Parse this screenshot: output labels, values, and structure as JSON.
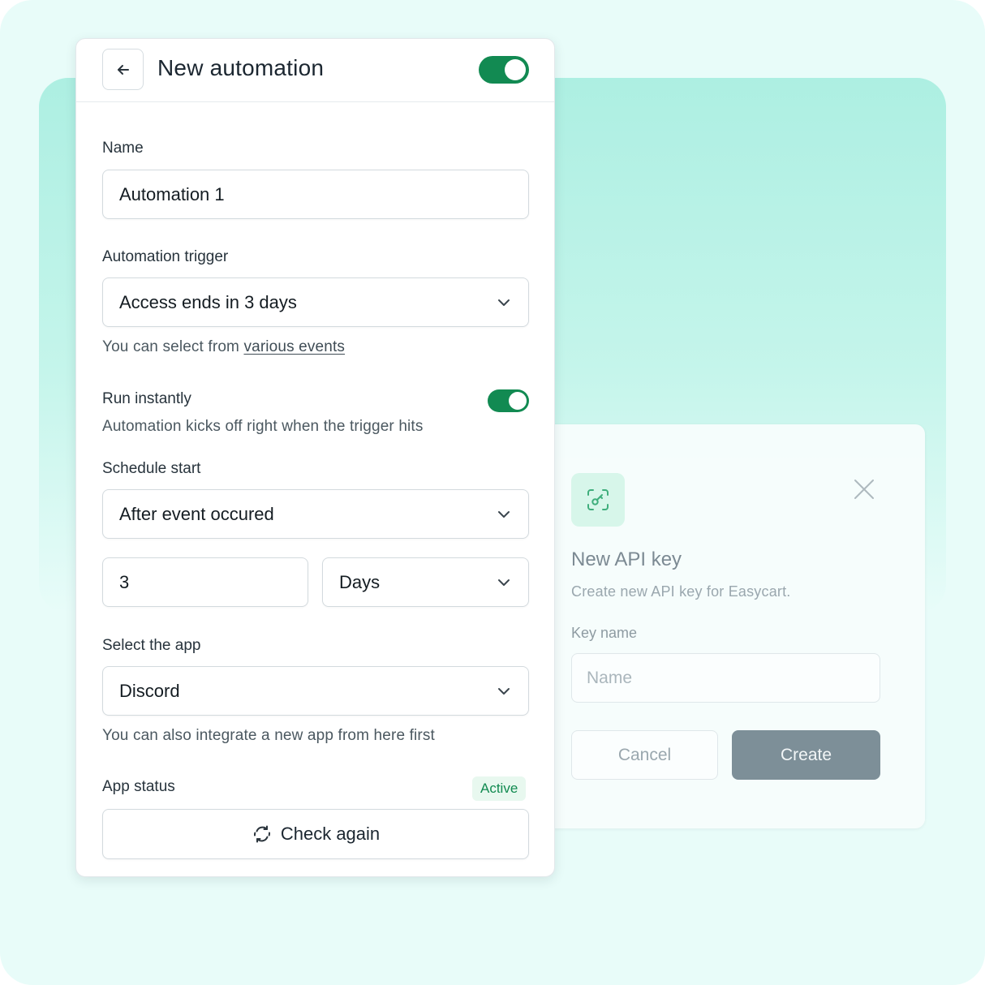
{
  "automation": {
    "title": "New automation",
    "enabled": true,
    "name_label": "Name",
    "name_value": "Automation 1",
    "trigger_label": "Automation trigger",
    "trigger_value": "Access ends in 3 days",
    "trigger_helper_prefix": "You can select from ",
    "trigger_helper_link": "various events",
    "run_instantly_label": "Run instantly",
    "run_instantly_enabled": true,
    "run_instantly_helper": "Automation kicks off right when the trigger hits",
    "schedule_label": "Schedule start",
    "schedule_value": "After event occured",
    "delay_amount": "3",
    "delay_unit": "Days",
    "app_label": "Select the app",
    "app_value": "Discord",
    "app_helper": "You can also integrate a new app from here first",
    "app_status_label": "App status",
    "app_status_badge": "Active",
    "check_again_label": "Check again"
  },
  "api_key_dialog": {
    "title": "New API key",
    "subtitle": "Create new API key for Easycart.",
    "key_name_label": "Key name",
    "key_name_placeholder": "Name",
    "cancel_label": "Cancel",
    "create_label": "Create"
  },
  "colors": {
    "accent_green": "#128a52",
    "canvas_bg": "#e8fcf9",
    "backdrop_mint": "#adefe2",
    "create_button": "#7d8f98"
  },
  "icons": {
    "back": "arrow-left-icon",
    "chevron": "chevron-down-icon",
    "refresh": "refresh-icon",
    "close": "close-icon",
    "api": "scan-key-icon"
  }
}
